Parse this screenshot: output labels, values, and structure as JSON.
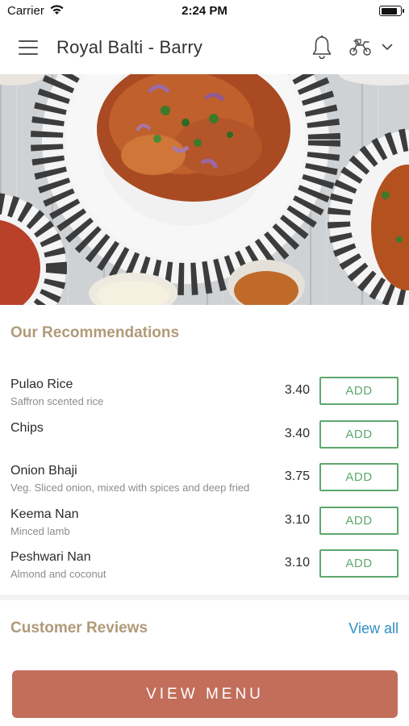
{
  "status_bar": {
    "carrier": "Carrier",
    "time": "2:24 PM",
    "battery_level": 0.9
  },
  "nav": {
    "title": "Royal Balti - Barry",
    "icons": [
      "menu-icon",
      "bell-icon",
      "delivery-icon",
      "chevron-down-icon"
    ]
  },
  "hero": {
    "image": "food-dishes-photo"
  },
  "recommendations": {
    "title": "Our Recommendations",
    "items": [
      {
        "name": "Pulao Rice",
        "description": "Saffron scented rice",
        "price": "3.40",
        "add_label": "ADD"
      },
      {
        "name": "Chips",
        "description": "",
        "price": "3.40",
        "add_label": "ADD"
      },
      {
        "name": "Onion Bhaji",
        "description": "Veg. Sliced onion, mixed with spices and deep fried",
        "price": "3.75",
        "add_label": "ADD"
      },
      {
        "name": "Keema Nan",
        "description": "Minced lamb",
        "price": "3.10",
        "add_label": "ADD"
      },
      {
        "name": "Peshwari Nan",
        "description": "Almond and coconut",
        "price": "3.10",
        "add_label": "ADD"
      }
    ]
  },
  "reviews": {
    "title": "Customer Reviews",
    "view_all_label": "View all"
  },
  "footer": {
    "view_menu_label": "VIEW MENU"
  },
  "colors": {
    "accent_gold": "#b09a78",
    "add_green": "#5ea86e",
    "link_blue": "#2f8fc4",
    "cta_terracotta": "#c26e5b"
  }
}
